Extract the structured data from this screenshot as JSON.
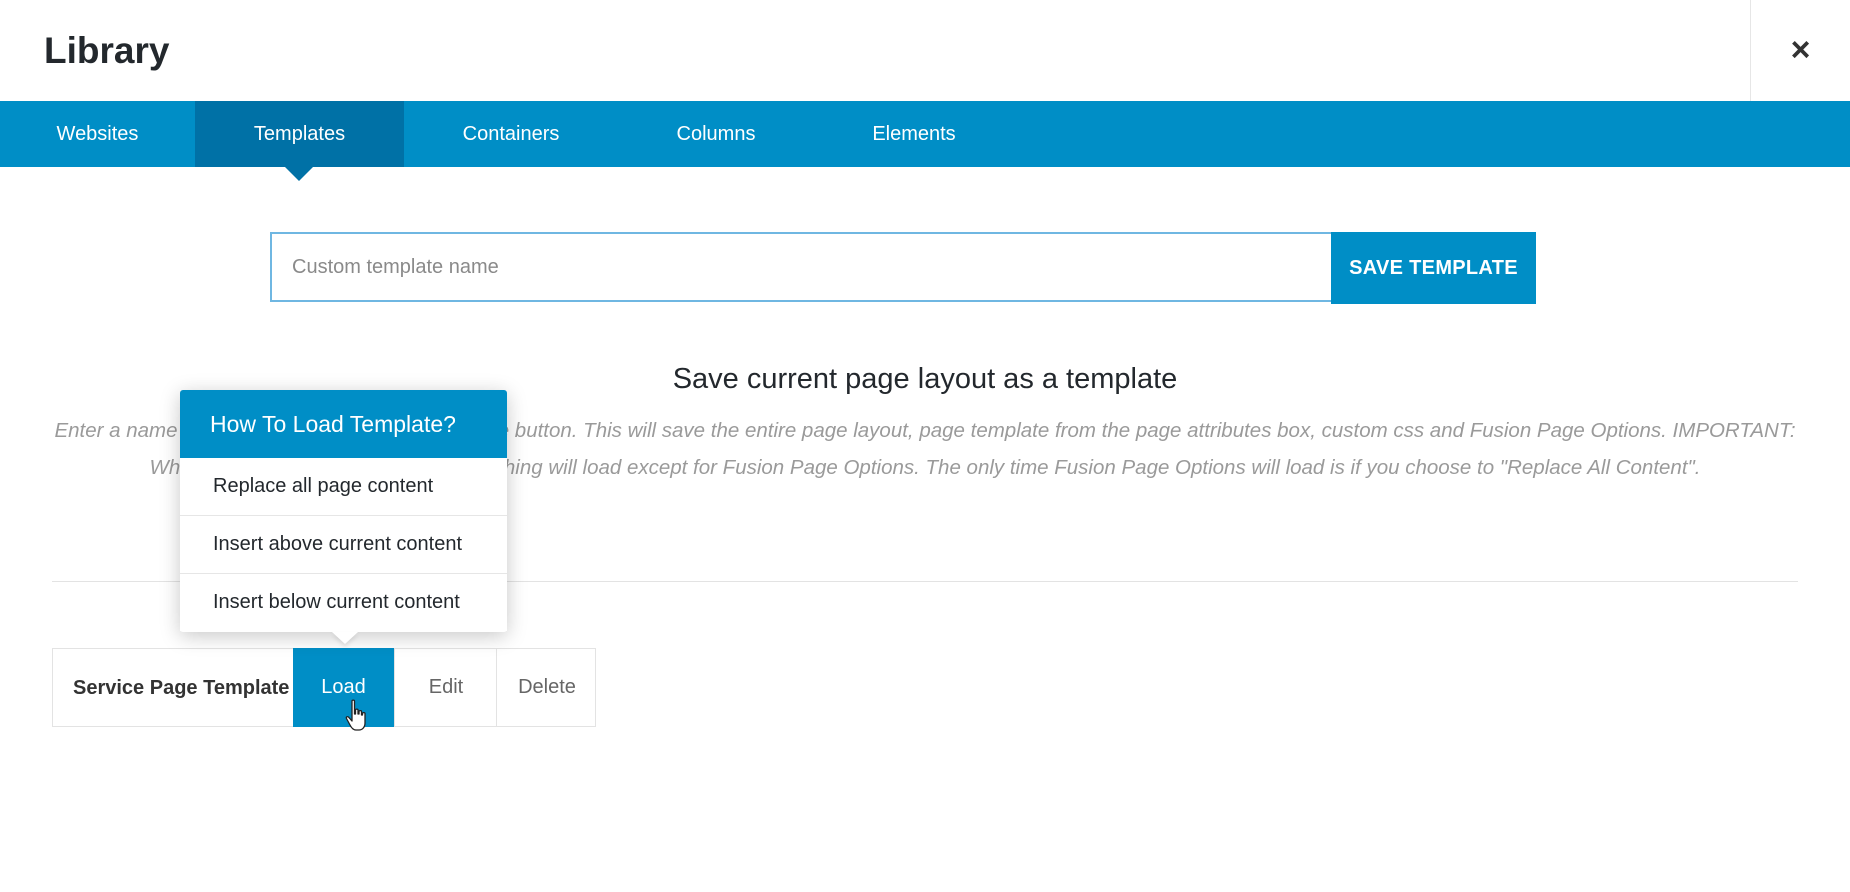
{
  "header": {
    "title": "Library",
    "close_icon": "×"
  },
  "tabs": [
    {
      "label": "Websites"
    },
    {
      "label": "Templates",
      "active": true
    },
    {
      "label": "Containers"
    },
    {
      "label": "Columns"
    },
    {
      "label": "Elements"
    }
  ],
  "save_form": {
    "placeholder": "Custom template name",
    "value": "",
    "button_label": "SAVE TEMPLATE"
  },
  "section": {
    "heading": "Save current page layout as a template",
    "description": "Enter a name for your template and click the Save button. This will save the entire page layout, page template from the page attributes box, custom css and Fusion Page Options. IMPORTANT: When loading a saved template, everything will load except for Fusion Page Options. The only time Fusion Page Options will load is if you choose to \"Replace All Content\"."
  },
  "popup": {
    "title": "How To Load Template?",
    "items": [
      {
        "label": "Replace all page content"
      },
      {
        "label": "Insert above current content"
      },
      {
        "label": "Insert below current content"
      }
    ]
  },
  "templates": [
    {
      "name": "Service Page Template",
      "load_label": "Load",
      "edit_label": "Edit",
      "delete_label": "Delete"
    }
  ],
  "colors": {
    "accent": "#008ec6",
    "accent_active": "#0071a6",
    "input_border": "#6fb7e2"
  },
  "icons": {
    "close": "close-icon",
    "cursor": "hand-pointer-icon"
  }
}
